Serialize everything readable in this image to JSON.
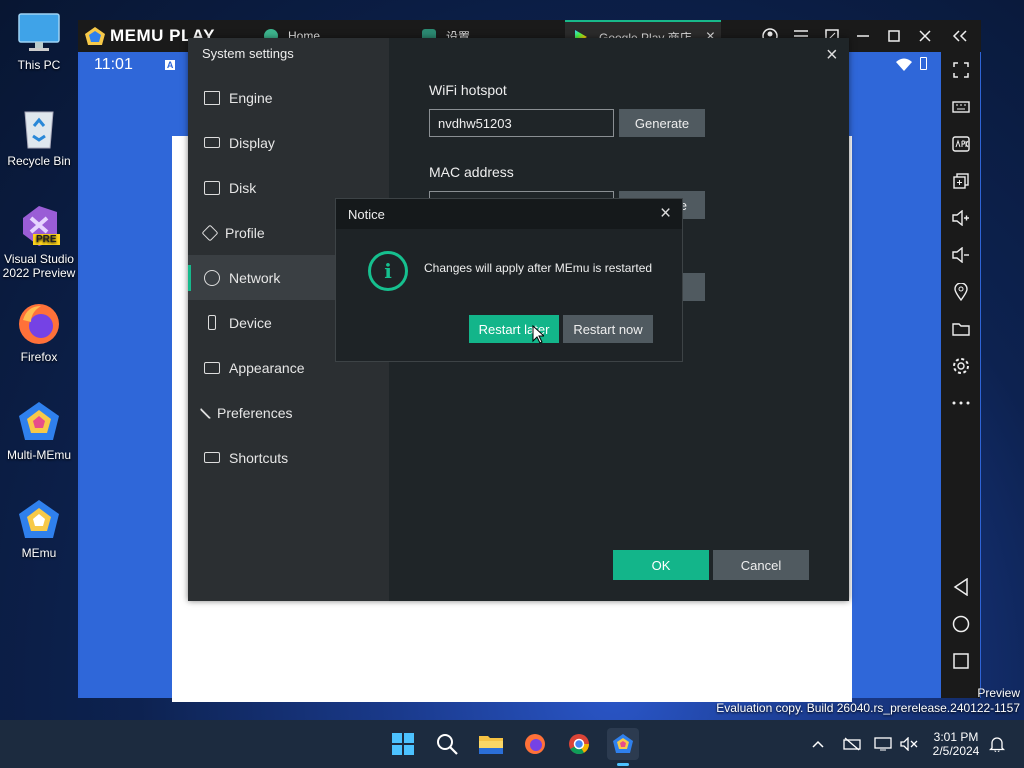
{
  "desktop": {
    "icons": [
      {
        "label": "This PC"
      },
      {
        "label": "Recycle Bin"
      },
      {
        "label": "Visual Studio 2022 Preview",
        "badge": "PRE"
      },
      {
        "label": "Firefox"
      },
      {
        "label": "Multi-MEmu"
      },
      {
        "label": "MEmu"
      }
    ],
    "watermark_line1": "Preview",
    "watermark_line2": "Evaluation copy. Build 26040.rs_prerelease.240122-1157"
  },
  "memu": {
    "logo_text": "MEMU PLAY",
    "tabs": [
      {
        "label": "Home"
      },
      {
        "label": "设置"
      },
      {
        "label": "Google Play 商店"
      }
    ],
    "tab_close": "×",
    "status_time": "11:01",
    "status_badge": "A"
  },
  "settings": {
    "title": "System settings",
    "close": "×",
    "nav": [
      {
        "label": "Engine"
      },
      {
        "label": "Display"
      },
      {
        "label": "Disk"
      },
      {
        "label": "Profile"
      },
      {
        "label": "Network"
      },
      {
        "label": "Device"
      },
      {
        "label": "Appearance"
      },
      {
        "label": "Preferences"
      },
      {
        "label": "Shortcuts"
      }
    ],
    "active_nav": "Network",
    "wifi_label": "WiFi hotspot",
    "wifi_value": "nvdhw51203",
    "generate_label": "Generate",
    "mac_label": "MAC address",
    "mac_btn_partial": "e",
    "ok_label": "OK",
    "cancel_label": "Cancel"
  },
  "notice": {
    "title": "Notice",
    "close": "×",
    "icon_glyph": "i",
    "message": "Changes will apply after MEmu is restarted",
    "restart_later": "Restart later",
    "restart_now": "Restart now"
  },
  "taskbar": {
    "time": "3:01 PM",
    "date": "2/5/2024"
  },
  "colors": {
    "accent": "#13b58a",
    "dialog_bg": "#1f2528",
    "android_bg": "#2f67d9"
  }
}
